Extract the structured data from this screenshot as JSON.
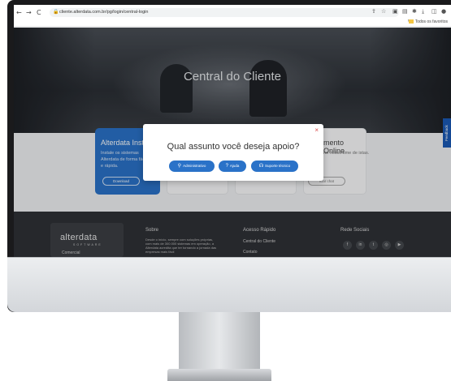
{
  "browser": {
    "nav_back": "←",
    "nav_forward": "→",
    "nav_reload": "C",
    "url": "cliente.alterdata.com.br/pg/login/central-login",
    "bookmarks_label": "Todos os favoritos",
    "bookmarks_chevron": "»"
  },
  "hero": {
    "title": "Central do Cliente"
  },
  "cards": [
    {
      "title": "Alterdata Insta",
      "text": "Instale os sistemas Alterdata de forma fácil e rápida.",
      "button": "Download"
    },
    {
      "title": "mento Online",
      "text": "no nosso time de istas.",
      "button": "iciar chat"
    }
  ],
  "feedback_tab": "Feedback",
  "modal": {
    "title": "Qual assunto você deseja apoio?",
    "close": "×",
    "buttons": [
      {
        "label": "Administrativo",
        "icon": "user-icon"
      },
      {
        "label": "Ajuda",
        "icon": "question-icon"
      },
      {
        "label": "Suporte técnico",
        "icon": "headset-icon"
      }
    ]
  },
  "footer": {
    "logo": "alterdata",
    "logo_sub": "SOFTWARE",
    "logo_comercial": "Comercial",
    "sobre_title": "Sobre",
    "sobre_text": "Desde o início, sempre com soluções próprias, com mais de 300.000 sistemas em operação, a Alterdata acredita que ter tornando a jornada das empresas mais fácil",
    "acesso_title": "Acesso Rápido",
    "acesso_links": [
      "Central do Cliente",
      "Contato"
    ],
    "redes_title": "Rede Sociais",
    "social_icons": [
      "facebook-icon",
      "linkedin-icon",
      "twitter-icon",
      "instagram-icon",
      "youtube-icon"
    ]
  }
}
